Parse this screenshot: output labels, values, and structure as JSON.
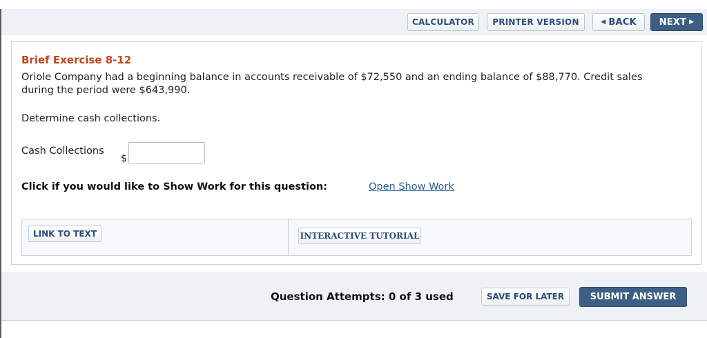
{
  "toolbar": {
    "calculator_label": "CALCULATOR",
    "printer_label": "PRINTER VERSION",
    "back_label": "BACK",
    "next_label": "NEXT"
  },
  "exercise": {
    "title": "Brief Exercise 8-12",
    "body": "Oriole Company had a beginning balance in accounts receivable of $72,550 and an ending balance of $88,770. Credit sales during the period were $643,990.",
    "instruction": "Determine cash collections.",
    "answer_label": "Cash Collections",
    "currency_symbol": "$",
    "answer_value": "",
    "show_work_prompt": "Click if you would like to Show Work for this question:",
    "show_work_link": "Open Show Work"
  },
  "resources": {
    "link_to_text_label": "LINK TO TEXT",
    "tutorial_label": "INTERACTIVE TUTORIAL"
  },
  "footer": {
    "attempts_text": "Question Attempts: 0 of 3 used",
    "save_label": "SAVE FOR LATER",
    "submit_label": "SUBMIT ANSWER"
  },
  "colors": {
    "accent_button": "#3d5f85",
    "title_orange": "#c0461c",
    "link_blue": "#2a5f9a",
    "bar_background": "#eef2f6"
  },
  "icons": {
    "back": "chevron-left-icon",
    "next": "chevron-right-icon"
  }
}
